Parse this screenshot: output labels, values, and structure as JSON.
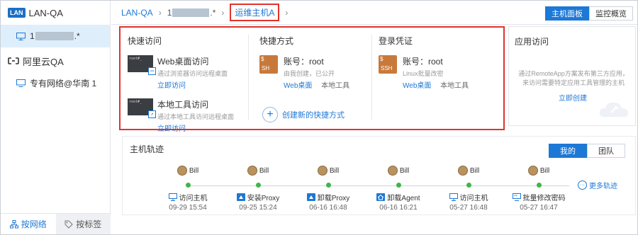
{
  "sidebar": {
    "header_badge": "LAN",
    "header_title": "LAN-QA",
    "host_prefix": "1",
    "host_suffix": ".*",
    "cloud_title": "阿里云QA",
    "network_item": "专有网络@华南 1",
    "tabs": [
      {
        "label": "按网络",
        "active": true
      },
      {
        "label": "按标签",
        "active": false
      }
    ]
  },
  "breadcrumb": {
    "root": "LAN-QA",
    "middle_prefix": "1",
    "middle_suffix": ".*",
    "current": "运维主机A"
  },
  "top_buttons": {
    "dashboard": "主机面板",
    "monitor": "监控概览"
  },
  "quick_access": {
    "title": "快速访问",
    "items": [
      {
        "title": "Web桌面访问",
        "desc": "通过浏览器访问远程桌面",
        "link": "立即访问"
      },
      {
        "title": "本地工具访问",
        "desc": "通过本地工具访问远程桌面",
        "link": "立即访问"
      }
    ]
  },
  "shortcuts": {
    "title": "快捷方式",
    "account": "账号：root",
    "desc": "由我创建，已公开",
    "link_web": "Web桌面",
    "link_local": "本地工具",
    "create": "创建新的快捷方式"
  },
  "credentials": {
    "title": "登录凭证",
    "account": "账号：root",
    "desc": "Linux批量改密",
    "link_web": "Web桌面",
    "link_local": "本地工具",
    "icon_label": "SSH"
  },
  "app_access": {
    "title": "应用访问",
    "desc": "通过RemoteApp方案发布第三方应用，来访问需要特定应用工具管理的主机",
    "link": "立即创建"
  },
  "trajectory": {
    "title": "主机轨迹",
    "tabs": [
      {
        "label": "我的",
        "active": true
      },
      {
        "label": "团队",
        "active": false
      }
    ],
    "events": [
      {
        "user": "Bill",
        "action": "访问主机",
        "time": "09-29 15:54",
        "icon": "monitor-icon"
      },
      {
        "user": "Bill",
        "action": "安装Proxy",
        "time": "09-25 15:24",
        "icon": "proxy-icon"
      },
      {
        "user": "Bill",
        "action": "卸载Proxy",
        "time": "06-16 16:48",
        "icon": "proxy-icon"
      },
      {
        "user": "Bill",
        "action": "卸载Agent",
        "time": "06-16 16:21",
        "icon": "agent-icon"
      },
      {
        "user": "Bill",
        "action": "访问主机",
        "time": "05-27 16:48",
        "icon": "monitor-icon"
      },
      {
        "user": "Bill",
        "action": "批量修改密码",
        "time": "05-27 16:47",
        "icon": "password-icon"
      }
    ],
    "more": "更多轨迹"
  },
  "colors": {
    "accent": "#1d78d6",
    "highlight_border": "#e0332d",
    "status_green": "#3fb54a",
    "ssh_orange": "#c8793a"
  }
}
